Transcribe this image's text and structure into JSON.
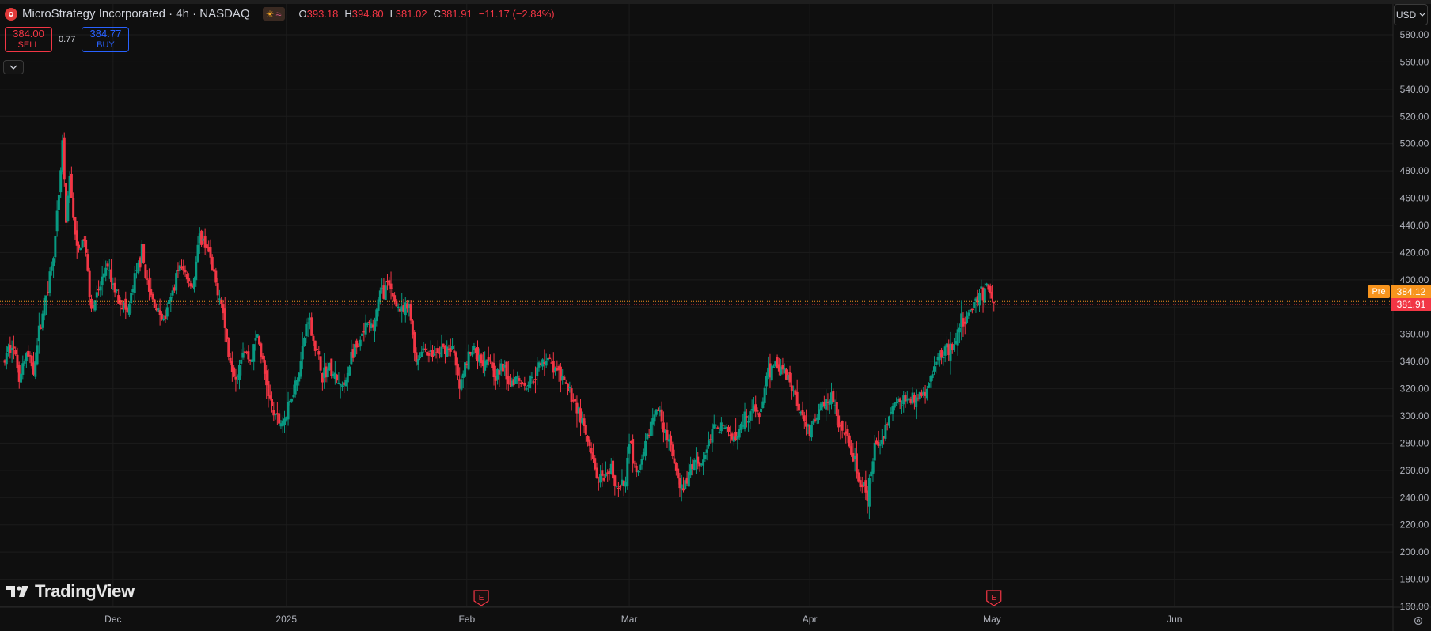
{
  "header": {
    "symbol_title": "MicroStrategy Incorporated · 4h · NASDAQ",
    "ohlc": {
      "o_label": "O",
      "o_value": "393.18",
      "h_label": "H",
      "h_value": "394.80",
      "l_label": "L",
      "l_value": "381.02",
      "c_label": "C",
      "c_value": "381.91",
      "change": "−11.17 (−2.84%)"
    },
    "session_icons": [
      "sun-icon",
      "wave-icon"
    ]
  },
  "trade": {
    "sell_price": "384.00",
    "sell_label": "SELL",
    "spread": "0.77",
    "buy_price": "384.77",
    "buy_label": "BUY"
  },
  "currency": "USD",
  "price_tags": {
    "pre_label": "Pre",
    "pre_price": "384.12",
    "last_price": "381.91"
  },
  "branding": "TradingView",
  "colors": {
    "up": "#089981",
    "down": "#f23645",
    "pre": "#f7941d",
    "background": "#0f0f0f",
    "grid": "#1c1c1c"
  },
  "chart_data": {
    "type": "candlestick",
    "ylim": [
      160,
      590
    ],
    "y_ticks": [
      160,
      180,
      200,
      220,
      240,
      260,
      280,
      300,
      320,
      340,
      360,
      380,
      400,
      420,
      440,
      460,
      480,
      500,
      520,
      540,
      560,
      580
    ],
    "y_tick_labels": [
      "160.00",
      "180.00",
      "200.00",
      "220.00",
      "240.00",
      "260.00",
      "280.00",
      "300.00",
      "320.00",
      "340.00",
      "360.00",
      "380.00",
      "400.00",
      "420.00",
      "440.00",
      "460.00",
      "480.00",
      "500.00",
      "520.00",
      "540.00",
      "560.00",
      "580.00"
    ],
    "x_labels": [
      {
        "label": "Dec",
        "x": 30
      },
      {
        "label": "2025",
        "x": 78
      },
      {
        "label": "Feb",
        "x": 128
      },
      {
        "label": "Mar",
        "x": 173
      },
      {
        "label": "Apr",
        "x": 223
      },
      {
        "label": "May",
        "x": 273.5
      },
      {
        "label": "Jun",
        "x": 324
      }
    ],
    "xlim": [
      0,
      360
    ],
    "earnings_markers": [
      {
        "x": 132,
        "label": "E"
      },
      {
        "x": 274,
        "label": "E"
      }
    ],
    "last_price": 381.91,
    "pre_price": 384.12,
    "anchors": [
      [
        0,
        340
      ],
      [
        2,
        355
      ],
      [
        4,
        330
      ],
      [
        6,
        345
      ],
      [
        8,
        335
      ],
      [
        10,
        370
      ],
      [
        12,
        395
      ],
      [
        14,
        430
      ],
      [
        15,
        460
      ],
      [
        16,
        500
      ],
      [
        17,
        440
      ],
      [
        18,
        475
      ],
      [
        20,
        420
      ],
      [
        22,
        430
      ],
      [
        24,
        380
      ],
      [
        26,
        390
      ],
      [
        28,
        410
      ],
      [
        30,
        395
      ],
      [
        32,
        385
      ],
      [
        34,
        375
      ],
      [
        36,
        400
      ],
      [
        38,
        420
      ],
      [
        40,
        390
      ],
      [
        42,
        380
      ],
      [
        44,
        370
      ],
      [
        46,
        385
      ],
      [
        48,
        410
      ],
      [
        50,
        405
      ],
      [
        52,
        395
      ],
      [
        54,
        430
      ],
      [
        56,
        425
      ],
      [
        58,
        400
      ],
      [
        60,
        385
      ],
      [
        62,
        345
      ],
      [
        64,
        330
      ],
      [
        66,
        350
      ],
      [
        68,
        340
      ],
      [
        70,
        360
      ],
      [
        72,
        330
      ],
      [
        74,
        305
      ],
      [
        76,
        295
      ],
      [
        78,
        300
      ],
      [
        80,
        320
      ],
      [
        82,
        340
      ],
      [
        84,
        375
      ],
      [
        86,
        350
      ],
      [
        88,
        330
      ],
      [
        90,
        335
      ],
      [
        92,
        325
      ],
      [
        94,
        320
      ],
      [
        96,
        345
      ],
      [
        98,
        350
      ],
      [
        100,
        365
      ],
      [
        102,
        365
      ],
      [
        104,
        390
      ],
      [
        106,
        395
      ],
      [
        108,
        385
      ],
      [
        110,
        375
      ],
      [
        112,
        380
      ],
      [
        114,
        340
      ],
      [
        116,
        350
      ],
      [
        118,
        345
      ],
      [
        120,
        345
      ],
      [
        122,
        350
      ],
      [
        124,
        350
      ],
      [
        126,
        320
      ],
      [
        128,
        340
      ],
      [
        130,
        350
      ],
      [
        132,
        340
      ],
      [
        134,
        345
      ],
      [
        136,
        330
      ],
      [
        138,
        335
      ],
      [
        140,
        325
      ],
      [
        142,
        330
      ],
      [
        144,
        322
      ],
      [
        146,
        328
      ],
      [
        148,
        335
      ],
      [
        150,
        345
      ],
      [
        152,
        335
      ],
      [
        154,
        328
      ],
      [
        156,
        320
      ],
      [
        158,
        310
      ],
      [
        160,
        295
      ],
      [
        162,
        275
      ],
      [
        164,
        255
      ],
      [
        166,
        250
      ],
      [
        168,
        260
      ],
      [
        170,
        245
      ],
      [
        172,
        250
      ],
      [
        173,
        285
      ],
      [
        175,
        255
      ],
      [
        177,
        270
      ],
      [
        179,
        295
      ],
      [
        181,
        305
      ],
      [
        183,
        290
      ],
      [
        185,
        270
      ],
      [
        187,
        245
      ],
      [
        189,
        252
      ],
      [
        191,
        268
      ],
      [
        193,
        265
      ],
      [
        195,
        280
      ],
      [
        197,
        295
      ],
      [
        199,
        293
      ],
      [
        201,
        285
      ],
      [
        203,
        290
      ],
      [
        205,
        300
      ],
      [
        207,
        305
      ],
      [
        209,
        300
      ],
      [
        211,
        325
      ],
      [
        213,
        340
      ],
      [
        215,
        335
      ],
      [
        217,
        330
      ],
      [
        219,
        315
      ],
      [
        221,
        300
      ],
      [
        223,
        290
      ],
      [
        225,
        300
      ],
      [
        227,
        310
      ],
      [
        229,
        315
      ],
      [
        231,
        292
      ],
      [
        233,
        283
      ],
      [
        235,
        270
      ],
      [
        237,
        250
      ],
      [
        239,
        240
      ],
      [
        241,
        275
      ],
      [
        243,
        285
      ],
      [
        245,
        300
      ],
      [
        247,
        310
      ],
      [
        249,
        312
      ],
      [
        251,
        310
      ],
      [
        253,
        315
      ],
      [
        255,
        318
      ],
      [
        257,
        330
      ],
      [
        259,
        345
      ],
      [
        261,
        350
      ],
      [
        263,
        350
      ],
      [
        265,
        370
      ],
      [
        267,
        375
      ],
      [
        269,
        385
      ],
      [
        271,
        390
      ],
      [
        272,
        395
      ],
      [
        273,
        392
      ],
      [
        274,
        382
      ]
    ]
  }
}
